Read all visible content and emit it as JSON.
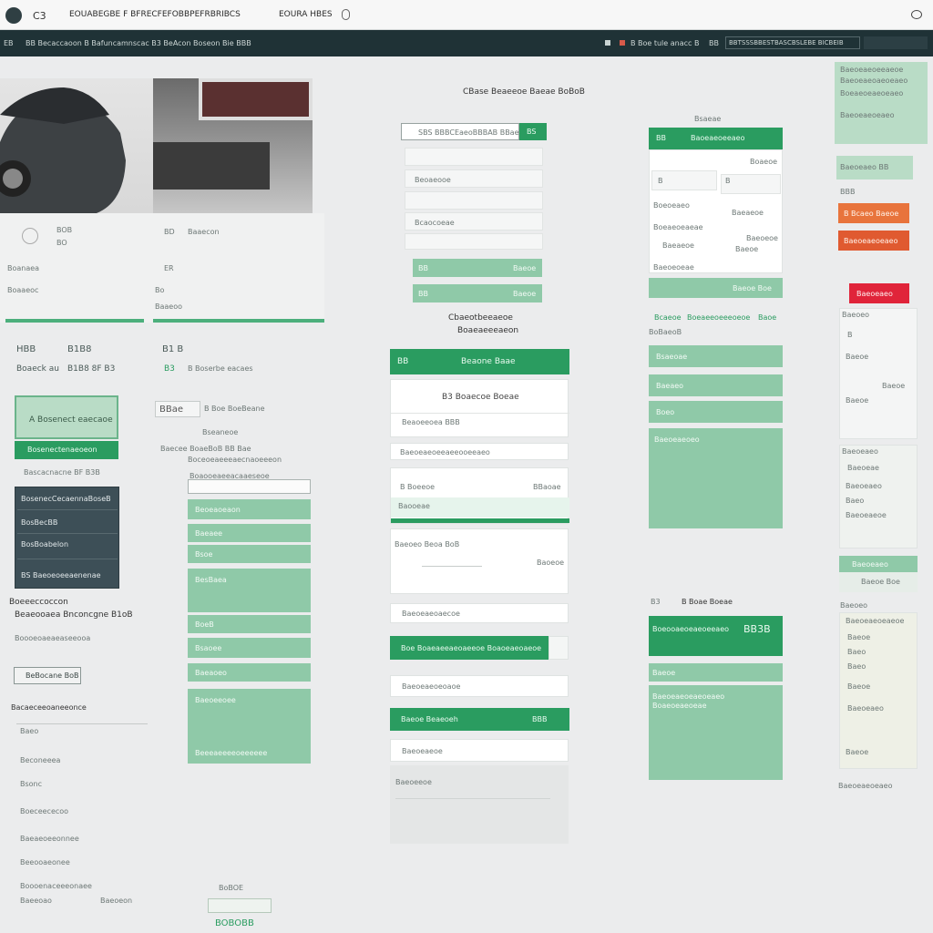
{
  "titlebar": {
    "logo_text": "C3",
    "nav_label": "EOUABEGBE F BFRECFEFOBBPEFRBRIBCS",
    "menu_label": "EOURA HBES"
  },
  "navbar": {
    "left_code": "EB",
    "breadcrumb": "BB Becaccaoon B Bafuncamnscac B3 BeAcon Boseon Bie BBB",
    "right_items": [
      "B",
      "Boe tule anaccae",
      "B",
      "BB"
    ],
    "search_value": "BBTSSSBBESTBASCBSLEBE BICBEIB"
  },
  "left": {
    "stats_a": [
      "BOB",
      "BO",
      "Boanaea",
      "Boaaeoc"
    ],
    "stats_b": [
      "BD",
      "Baaecon",
      "ER",
      "Bo",
      "Baaeoo"
    ],
    "row_a": [
      "HBB",
      "B1B8",
      "B1 B"
    ],
    "row_b": [
      "Boaeck au",
      "B1B8 8F B3",
      "B3",
      "B Boserbe eacaes"
    ],
    "banner_label": "A Bosenect eaecaoe",
    "banner_button": "Bosenectenaeoeon",
    "banner_caption": "Bascacnacne BF B3B",
    "dark_list": [
      "BosenecCecaennaBoseB",
      "BosBecBB",
      "BosBoabelon",
      "BS Baeoeoeeaenenae"
    ],
    "section_title": "Boeeeccoccon",
    "section_line": "Beaeooaea Bnconcgne B1oB",
    "section_sub": "Boooeoaeaeaseeooa",
    "outline_button": "BeBocane BoB",
    "list_title": "Bacaeceeoaneeonce",
    "list_items": [
      "Baeo",
      "Beconeeea",
      "Bsonc",
      "Boeceececoo",
      "Baeaeoeeonnee",
      "Beeooaeonee",
      "Boooenaceeeonaee",
      "Baeeoao",
      "Baeoeon"
    ],
    "footer_badge": "BoBOE",
    "footer_code": "BOBOBB"
  },
  "col2": {
    "header": "BBae",
    "header_line": "B Boe BoeBeane",
    "sub_a": "Bseaneoe",
    "sub_b": "Baecee BoaeBoB BB Bae",
    "sub_c": "Boceoeaeeeaecnaoeeeon",
    "search_label": "Boaooeaeeacaaeseoe",
    "rows": [
      "Beoeaoeaon",
      "Baeaee",
      "Bsoe",
      "BesBaea",
      "BoeB",
      "Bsaoee",
      "Baeaoeo",
      "Baeoeeoee",
      "Beeeaeeeeoeeeeee"
    ]
  },
  "form": {
    "title": "CBase Beaeeoe Baeae BoBoB",
    "search_value": "SBS BBBCEaeoBBBAB BBaeae",
    "search_button": "BS",
    "fields": [
      "",
      "Beoaeooe",
      "",
      "Bcaocoeae",
      ""
    ],
    "btn_a": "BB",
    "btn_a_label": "Baeoe",
    "btn_b": "BB",
    "btn_b_label": "Baeoe"
  },
  "mid": {
    "caption_a": "Cbaeotbeeaeoe",
    "caption_b": "Boaeaeeeaeon",
    "panel_title": "Beaone Baae",
    "panel_code": "BB",
    "card1_title": "B3 Boaecoe Boeae",
    "card1_sub": "Beaoeeoea BBB",
    "card1_line": "Baeoeaeoeeaeeooeeaeo",
    "card2_title": "B Boeeoe",
    "card2_code": "BBaoae",
    "card2_line": "Baooeae",
    "card3_title": "Baeoeo Beoa BoB",
    "card3_code": "Baoeoe",
    "input_a": "Baeoeaeoaecoe",
    "wide_button": "Boe Boaeaeeaeoaeeoe Boaoeaeoaeoe",
    "input_b": "Baeoeaeoeoaoe",
    "green_bar": "Baeoe Beaeoeh",
    "green_bar_code": "BBB",
    "input_c": "Baeoeaeoe",
    "bottom_label": "Baeoeeoe"
  },
  "col4": {
    "top_caption": "Bsaeae",
    "panel_header": "BB",
    "panel_header_label": "Baoeaeoeeaeo",
    "grid_items": [
      "B",
      "B",
      "Boeoeaeo",
      "Baeaeoe",
      "Boeaeoeaeae",
      "Baeoeoe",
      "Baeaeoe",
      "Baeoe",
      "Baeoeoeae",
      "Boaeoe"
    ],
    "green_button": "Baeoe Boe",
    "tabs": [
      "Bcaeoe",
      "Boeaeeoeeeoeoe Bie",
      "Baoe"
    ],
    "sub_caption": "BoBaeoB",
    "list": [
      "Bsaeoae",
      "Baeaeo",
      "Boeo"
    ],
    "box_title": "Baeoeaeoeo",
    "section_label": "B3",
    "section_title": "B Boae Boeae",
    "dark_title": "Boeooaeoeaeoeeaeo",
    "dark_code": "BB3B",
    "bar_label": "Baeoe",
    "panel_lines": [
      "Baeoeaeoeaeoeaeo",
      "Boaeoeaeoeae"
    ]
  },
  "right": {
    "box_lines": [
      "Baeoeaeoeeaeoe",
      "Baeoeaeoaeoeaeo",
      "Boeaeoeaeoeaeo",
      "Baeoeaeoeaeo"
    ],
    "link_box": "Baeoeaeo BB",
    "code": "BBB",
    "orange_a": "B Bcaeo Baeoe",
    "orange_b": "Baeoeaeoeaeo",
    "red_button": "Baeoeaeo",
    "card_title": "Baeoeo",
    "card_lines": [
      "B",
      "Baeoe",
      "Baeoe",
      "Baeoe"
    ],
    "card2_title": "Baeoeaeo",
    "card2_lines": [
      "Baeoeae",
      "Baeoeaeo",
      "Baeo",
      "Baeoeaeoe"
    ],
    "green_small": "Baeoeaeo",
    "green_small_sub": "Baeoe Boe",
    "card3_title": "Baeoeo",
    "card3_lines": [
      "Baeoeaeoeaeoe",
      "Baeoe",
      "Baeo",
      "Baeo",
      "Baeoe",
      "Baeoeaeo",
      "Baeoe"
    ],
    "footer": "Baeoeaeoeaeo"
  },
  "colors": {
    "accent": "#2a9c60",
    "accent_light": "#8fc9a8",
    "navbar": "#1f3236",
    "dark_card": "#3d4f57",
    "orange": "#e8743c",
    "red": "#e0243a"
  }
}
